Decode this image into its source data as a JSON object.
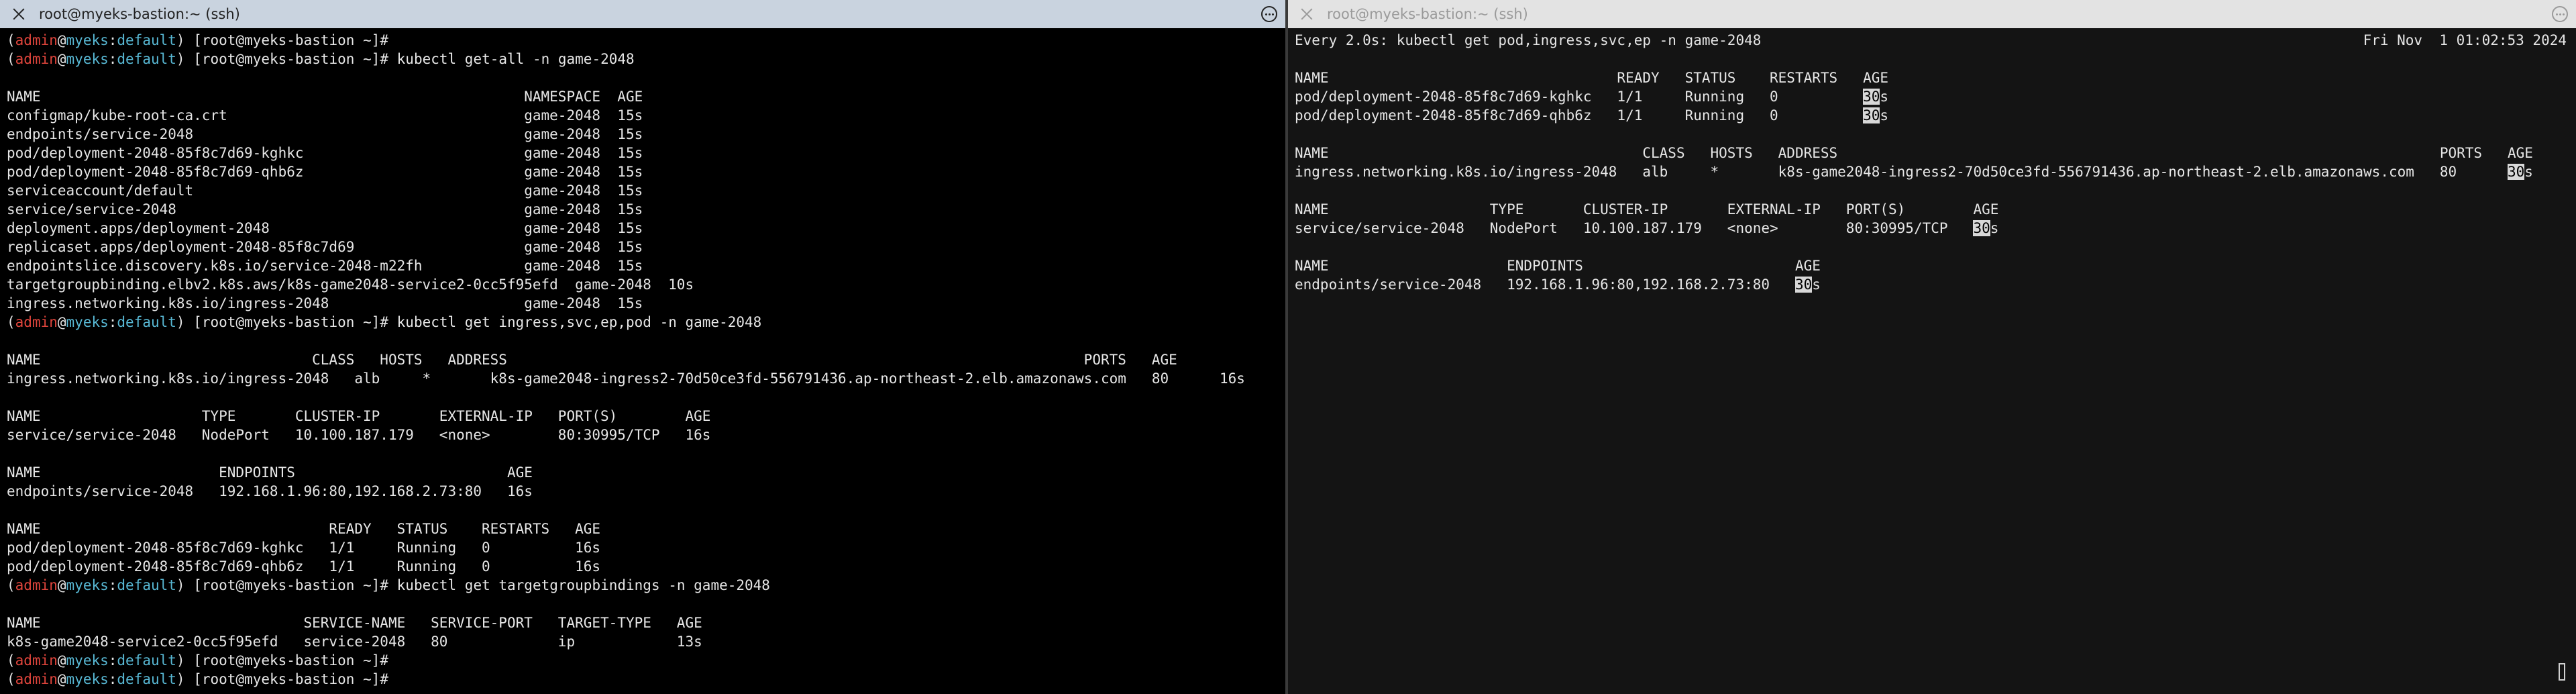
{
  "left_window": {
    "title": "root@myeks-bastion:~ (ssh)",
    "prompt": {
      "user": "admin",
      "at": "@",
      "host": "myeks",
      "colon": ":",
      "ctx": "default",
      "shell": ") [root@myeks-bastion ~]# "
    },
    "lines": [
      {
        "type": "prompt",
        "cmd": ""
      },
      {
        "type": "prompt",
        "cmd": "kubectl get-all -n game-2048"
      },
      {
        "type": "text",
        "text": ""
      },
      {
        "type": "text",
        "text": "NAME                                                         NAMESPACE  AGE"
      },
      {
        "type": "text",
        "text": "configmap/kube-root-ca.crt                                   game-2048  15s"
      },
      {
        "type": "text",
        "text": "endpoints/service-2048                                       game-2048  15s"
      },
      {
        "type": "text",
        "text": "pod/deployment-2048-85f8c7d69-kghkc                          game-2048  15s"
      },
      {
        "type": "text",
        "text": "pod/deployment-2048-85f8c7d69-qhb6z                          game-2048  15s"
      },
      {
        "type": "text",
        "text": "serviceaccount/default                                       game-2048  15s"
      },
      {
        "type": "text",
        "text": "service/service-2048                                         game-2048  15s"
      },
      {
        "type": "text",
        "text": "deployment.apps/deployment-2048                              game-2048  15s"
      },
      {
        "type": "text",
        "text": "replicaset.apps/deployment-2048-85f8c7d69                    game-2048  15s"
      },
      {
        "type": "text",
        "text": "endpointslice.discovery.k8s.io/service-2048-m22fh            game-2048  15s"
      },
      {
        "type": "text",
        "text": "targetgroupbinding.elbv2.k8s.aws/k8s-game2048-service2-0cc5f95efd  game-2048  10s"
      },
      {
        "type": "text",
        "text": "ingress.networking.k8s.io/ingress-2048                       game-2048  15s"
      },
      {
        "type": "prompt",
        "cmd": "kubectl get ingress,svc,ep,pod -n game-2048"
      },
      {
        "type": "text",
        "text": ""
      },
      {
        "type": "text",
        "text": "NAME                                CLASS   HOSTS   ADDRESS                                                                    PORTS   AGE"
      },
      {
        "type": "text",
        "text": "ingress.networking.k8s.io/ingress-2048   alb     *       k8s-game2048-ingress2-70d50ce3fd-556791436.ap-northeast-2.elb.amazonaws.com   80      16s"
      },
      {
        "type": "text",
        "text": ""
      },
      {
        "type": "text",
        "text": "NAME                   TYPE       CLUSTER-IP       EXTERNAL-IP   PORT(S)        AGE"
      },
      {
        "type": "text",
        "text": "service/service-2048   NodePort   10.100.187.179   <none>        80:30995/TCP   16s"
      },
      {
        "type": "text",
        "text": ""
      },
      {
        "type": "text",
        "text": "NAME                     ENDPOINTS                         AGE"
      },
      {
        "type": "text",
        "text": "endpoints/service-2048   192.168.1.96:80,192.168.2.73:80   16s"
      },
      {
        "type": "text",
        "text": ""
      },
      {
        "type": "text",
        "text": "NAME                                  READY   STATUS    RESTARTS   AGE"
      },
      {
        "type": "text",
        "text": "pod/deployment-2048-85f8c7d69-kghkc   1/1     Running   0          16s"
      },
      {
        "type": "text",
        "text": "pod/deployment-2048-85f8c7d69-qhb6z   1/1     Running   0          16s"
      },
      {
        "type": "prompt",
        "cmd": "kubectl get targetgroupbindings -n game-2048"
      },
      {
        "type": "text",
        "text": ""
      },
      {
        "type": "text",
        "text": "NAME                               SERVICE-NAME   SERVICE-PORT   TARGET-TYPE   AGE"
      },
      {
        "type": "text",
        "text": "k8s-game2048-service2-0cc5f95efd   service-2048   80             ip            13s"
      },
      {
        "type": "prompt",
        "cmd": ""
      },
      {
        "type": "prompt",
        "cmd": ""
      }
    ]
  },
  "right_window": {
    "title": "root@myeks-bastion:~ (ssh)",
    "header_left": "Every 2.0s: kubectl get pod,ingress,svc,ep -n game-2048",
    "header_right": "Fri Nov  1 01:02:53 2024",
    "lines": [
      {
        "text": ""
      },
      {
        "text": "NAME                                  READY   STATUS    RESTARTS   AGE"
      },
      {
        "pre": "pod/deployment-2048-85f8c7d69-kghkc   1/1     Running   0          ",
        "hl": "30",
        "post": "s"
      },
      {
        "pre": "pod/deployment-2048-85f8c7d69-qhb6z   1/1     Running   0          ",
        "hl": "30",
        "post": "s"
      },
      {
        "text": ""
      },
      {
        "text": "NAME                                     CLASS   HOSTS   ADDRESS                                                                       PORTS   AGE"
      },
      {
        "pre": "ingress.networking.k8s.io/ingress-2048   alb     *       k8s-game2048-ingress2-70d50ce3fd-556791436.ap-northeast-2.elb.amazonaws.com   80      ",
        "hl": "30",
        "post": "s"
      },
      {
        "text": ""
      },
      {
        "text": "NAME                   TYPE       CLUSTER-IP       EXTERNAL-IP   PORT(S)        AGE"
      },
      {
        "pre": "service/service-2048   NodePort   10.100.187.179   <none>        80:30995/TCP   ",
        "hl": "30",
        "post": "s"
      },
      {
        "text": ""
      },
      {
        "text": "NAME                     ENDPOINTS                         AGE"
      },
      {
        "pre": "endpoints/service-2048   192.168.1.96:80,192.168.2.73:80   ",
        "hl": "30",
        "post": "s"
      }
    ]
  }
}
